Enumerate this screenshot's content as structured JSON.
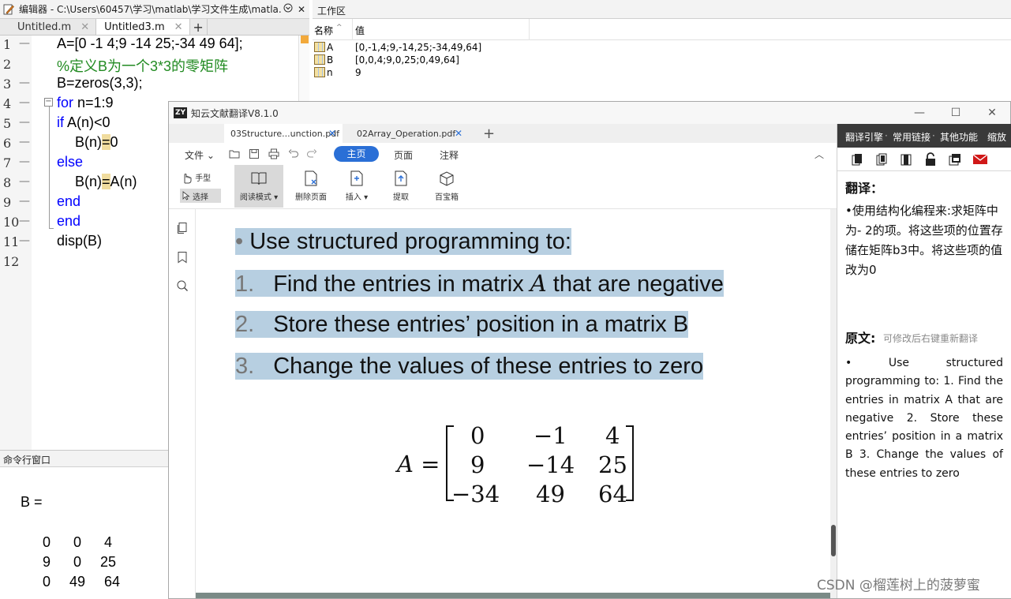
{
  "editor": {
    "title": "编辑器 - C:\\Users\\60457\\学习\\matlab\\学习文件生成\\matla...",
    "tabs": [
      {
        "label": "Untitled.m",
        "close": "✕"
      },
      {
        "label": "Untitled3.m",
        "close": "✕"
      }
    ],
    "add_tab": "+",
    "lines": [
      {
        "num": "1",
        "code": "A=[0 -1 4;9 -14 25;-34 49 64];"
      },
      {
        "num": "2",
        "code": "%定义B为一个3*3的零矩阵"
      },
      {
        "num": "3",
        "code": "B=zeros(3,3);"
      },
      {
        "num": "4",
        "code": "for n=1:9"
      },
      {
        "num": "5",
        "code": "if A(n)<0"
      },
      {
        "num": "6",
        "code_pre": "B(n)",
        "code_hl": "=",
        "code_post": "0"
      },
      {
        "num": "7",
        "code": "else"
      },
      {
        "num": "8",
        "code_pre": "B(n)",
        "code_hl": "=",
        "code_post": "A(n)"
      },
      {
        "num": "9",
        "code": "end"
      },
      {
        "num": "10",
        "code": "end"
      },
      {
        "num": "11",
        "code": "disp(B)"
      },
      {
        "num": "12",
        "code": ""
      }
    ],
    "tokens": {
      "for": "for",
      "n_range": " n=1:9",
      "if": "if",
      "cond": " A(n)<0"
    }
  },
  "command_window": {
    "title": "命令行窗口",
    "output_label": "B =",
    "rows": [
      [
        "0",
        "0",
        "4"
      ],
      [
        "9",
        "0",
        "25"
      ],
      [
        "0",
        "49",
        "64"
      ]
    ]
  },
  "workspace": {
    "title": "工作区",
    "col_name": "名称",
    "col_sort": "^",
    "col_value": "值",
    "vars": [
      {
        "name": "A",
        "value": "[0,-1,4;9,-14,25;-34,49,64]"
      },
      {
        "name": "B",
        "value": "[0,0,4;9,0,25;0,49,64]"
      },
      {
        "name": "n",
        "value": "9"
      }
    ]
  },
  "translator": {
    "logo": "ZY",
    "title": "知云文献翻译V8.1.0",
    "win_min": "—",
    "win_max": "☐",
    "win_close": "✕",
    "tabs": [
      {
        "label": "03Structure...unction.pdf",
        "close": "✕"
      },
      {
        "label": "02Array_Operation.pdf",
        "close": "✕"
      }
    ],
    "add_tab": "+",
    "menu": {
      "file": "文件 ⌄",
      "main": "主页",
      "page": "页面",
      "annotate": "注释",
      "collapse": "︿"
    },
    "toolbar": {
      "hand": "手型",
      "select": "选择",
      "read_mode": "阅读模式 ▾",
      "delete_page": "删除页面",
      "insert": "插入 ▾",
      "extract": "提取",
      "treasure": "百宝箱"
    },
    "pdf": {
      "bullet": "•",
      "headline": "Use structured programming to:",
      "items": [
        {
          "num": "1.",
          "text_pre": "Find the entries in matrix ",
          "text_var": "A",
          "text_post": " that are negative"
        },
        {
          "num": "2.",
          "text": "Store these entries’ position in a matrix B"
        },
        {
          "num": "3.",
          "text": "Change the values of these entries to zero"
        }
      ],
      "matrix_lhs": "A =",
      "matrix": [
        [
          "0",
          "−1",
          "4"
        ],
        [
          "9",
          "−14",
          "25"
        ],
        [
          "−34",
          "49",
          "64"
        ]
      ]
    },
    "panel": {
      "tabs": [
        "翻译引擎",
        "常用链接",
        "其他功能",
        "缩放"
      ],
      "dot": "·",
      "trans_head": "翻译：",
      "trans_text": "•使用结构化编程来:求矩阵中为- 2的项。将这些项的位置存储在矩阵b3中。将这些项的值改为0",
      "src_head": "原文:",
      "src_hint": "可修改后右键重新翻译",
      "src_text": "•  Use structured programming to: 1. Find the entries in matrix A that are negative 2. Store these entries’ position in a matrix B 3. Change the values of these entries to zero"
    }
  },
  "watermark": "CSDN @榴莲树上的菠萝蜜",
  "colors": {
    "accent": "#2a6fd6",
    "keyword": "#0000ff",
    "comment": "#228b22",
    "highlight": "#b7cfe1",
    "panel_dark": "#3a3a3a"
  }
}
